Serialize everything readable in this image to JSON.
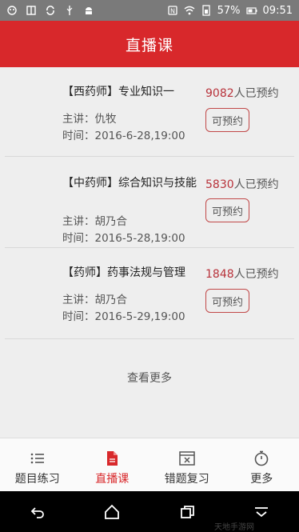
{
  "status_bar": {
    "battery": "57%",
    "time": "09:51"
  },
  "header": {
    "title": "直播课"
  },
  "courses": [
    {
      "title": "【西药师】专业知识一",
      "teacher": "主讲：仇牧",
      "time": "时间：2016-6-28,19:00",
      "count": "9082",
      "count_suffix": "人已预约",
      "button": "可预约"
    },
    {
      "title": "【中药师】综合知识与技能",
      "teacher": "主讲：胡乃合",
      "time": "时间：2016-5-28,19:00",
      "count": "5830",
      "count_suffix": "人已预约",
      "button": "可预约"
    },
    {
      "title": "【药师】药事法规与管理",
      "teacher": "主讲：胡乃合",
      "time": "时间：2016-5-29,19:00",
      "count": "1848",
      "count_suffix": "人已预约",
      "button": "可预约"
    }
  ],
  "more_label": "查看更多",
  "bottom_nav": [
    {
      "label": "题目练习",
      "icon": "list-icon",
      "active": false
    },
    {
      "label": "直播课",
      "icon": "document-icon",
      "active": true
    },
    {
      "label": "错题复习",
      "icon": "error-window-icon",
      "active": false
    },
    {
      "label": "更多",
      "icon": "stopwatch-icon",
      "active": false
    }
  ],
  "watermark": "天地手游网",
  "colors": {
    "brand_red": "#d8282b",
    "count_red": "#b8323a"
  }
}
